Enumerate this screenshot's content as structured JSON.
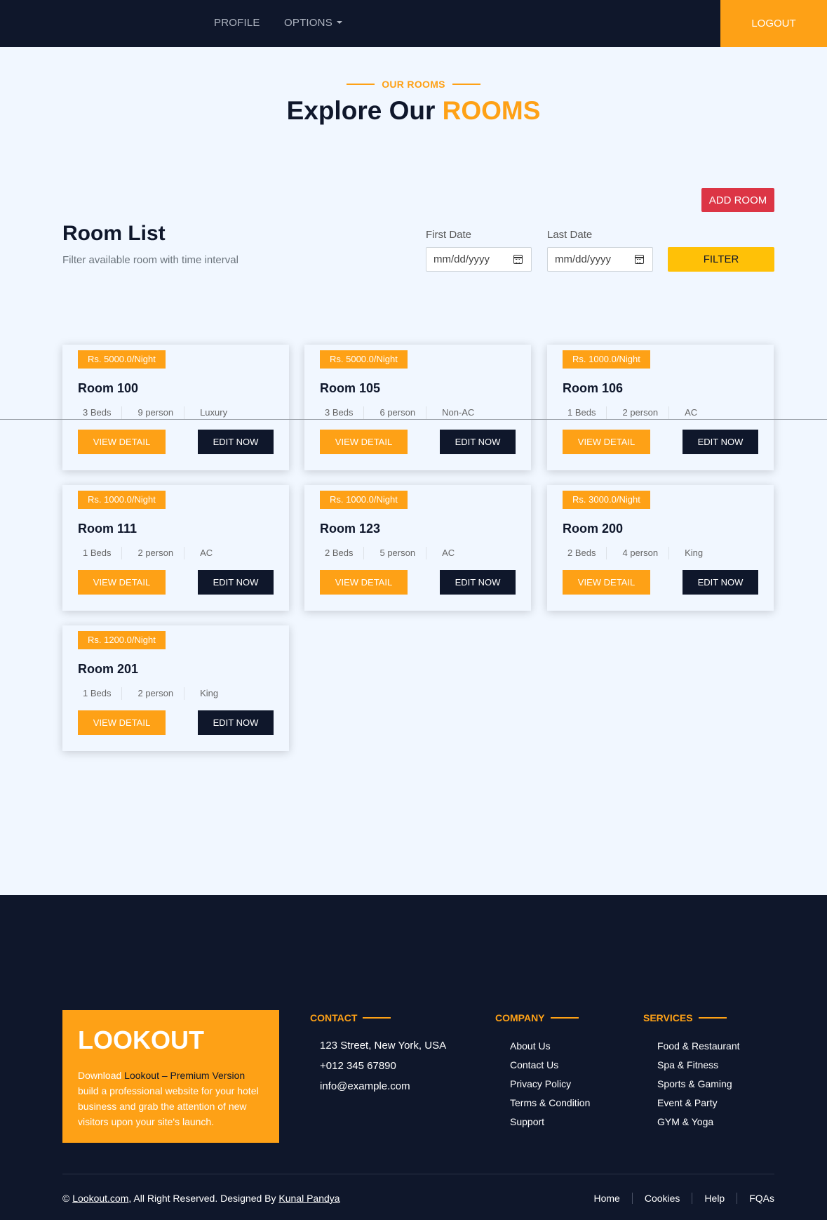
{
  "nav": {
    "profile": "PROFILE",
    "options": "OPTIONS",
    "logout": "LOGOUT"
  },
  "header": {
    "tag": "OUR ROOMS",
    "title_prefix": "Explore Our",
    "title_highlight": "ROOMS"
  },
  "room_list": {
    "add_room": "ADD ROOM",
    "title": "Room List",
    "subtitle": "Filter available room with time interval",
    "first_date_label": "First Date",
    "last_date_label": "Last Date",
    "date_placeholder": "mm/dd/yyyy",
    "filter": "FILTER"
  },
  "card_buttons": {
    "view": "VIEW DETAIL",
    "edit": "EDIT NOW"
  },
  "rooms": [
    {
      "price": "Rs. 5000.0/Night",
      "name": "Room 100",
      "beds": "3 Beds",
      "person": "9 person",
      "type": "Luxury"
    },
    {
      "price": "Rs. 5000.0/Night",
      "name": "Room 105",
      "beds": "3 Beds",
      "person": "6 person",
      "type": "Non-AC"
    },
    {
      "price": "Rs. 1000.0/Night",
      "name": "Room 106",
      "beds": "1 Beds",
      "person": "2 person",
      "type": "AC"
    },
    {
      "price": "Rs. 1000.0/Night",
      "name": "Room 111",
      "beds": "1 Beds",
      "person": "2 person",
      "type": "AC"
    },
    {
      "price": "Rs. 1000.0/Night",
      "name": "Room 123",
      "beds": "2 Beds",
      "person": "5 person",
      "type": "AC"
    },
    {
      "price": "Rs. 3000.0/Night",
      "name": "Room 200",
      "beds": "2 Beds",
      "person": "4 person",
      "type": "King"
    },
    {
      "price": "Rs. 1200.0/Night",
      "name": "Room 201",
      "beds": "1 Beds",
      "person": "2 person",
      "type": "King"
    }
  ],
  "footer": {
    "brand": "LOOKOUT",
    "brand_text_1": "Download",
    "brand_text_link": "Lookout – Premium Version",
    "brand_text_2": "build a professional website for your hotel business and grab the attention of new visitors upon your site's launch.",
    "contact_title": "CONTACT",
    "contact": [
      "123 Street, New York, USA",
      "+012 345 67890",
      "info@example.com"
    ],
    "company_title": "COMPANY",
    "company": [
      "About Us",
      "Contact Us",
      "Privacy Policy",
      "Terms & Condition",
      "Support"
    ],
    "services_title": "SERVICES",
    "services": [
      "Food & Restaurant",
      "Spa & Fitness",
      "Sports & Gaming",
      "Event & Party",
      "GYM & Yoga"
    ],
    "copyright_symbol": "©",
    "copyright_site": "Lookout.com",
    "copyright_mid": ", All Right Reserved. Designed By",
    "copyright_author": "Kunal Pandya",
    "menu": [
      "Home",
      "Cookies",
      "Help",
      "FQAs"
    ]
  },
  "colors": {
    "primary": "#fea116",
    "dark": "#0f172b",
    "danger": "#dc3545",
    "warning": "#ffc107",
    "background": "#f1f7ff"
  }
}
